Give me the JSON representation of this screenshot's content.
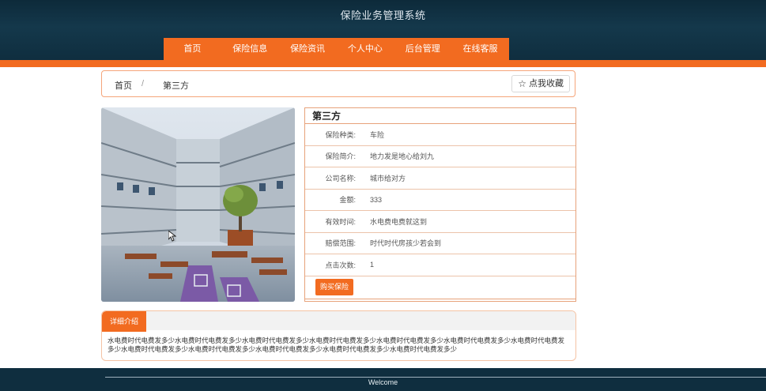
{
  "site": {
    "title": "保险业务管理系统"
  },
  "nav": {
    "items": [
      "首页",
      "保险信息",
      "保险资讯",
      "个人中心",
      "后台管理",
      "在线客服"
    ]
  },
  "breadcrumb": {
    "home": "首页",
    "separator": "/",
    "current": "第三方",
    "favorite_label": "点我收藏"
  },
  "detail": {
    "title": "第三方",
    "fields": [
      {
        "label": "保险种类:",
        "value": "车险"
      },
      {
        "label": "保险简介:",
        "value": "地力发是地心给刘九"
      },
      {
        "label": "公司名称:",
        "value": "城市给对方"
      },
      {
        "label": "金额:",
        "value": "333"
      },
      {
        "label": "有效时间:",
        "value": "水电费电费就这到"
      },
      {
        "label": "赔偿范围:",
        "value": "时代时代房孩少若会到"
      },
      {
        "label": "点击次数:",
        "value": "1"
      }
    ],
    "buy_label": "购买保险"
  },
  "intro": {
    "tab_label": "详细介绍",
    "text": "水电费时代电费发多少水电费时代电费发多少水电费时代电费发多少水电费时代电费发多少水电费时代电费发多少水电费时代电费发多少水电费时代电费发多少水电费时代电费发多少水电费时代电费发多少水电费时代电费发多少水电费时代电费发多少水电费时代电费发多少"
  },
  "footer": {
    "text": "Welcome"
  },
  "colors": {
    "accent": "#f26b20",
    "header": "#14384b"
  },
  "icons": {
    "favorite": "star-outline-icon"
  }
}
